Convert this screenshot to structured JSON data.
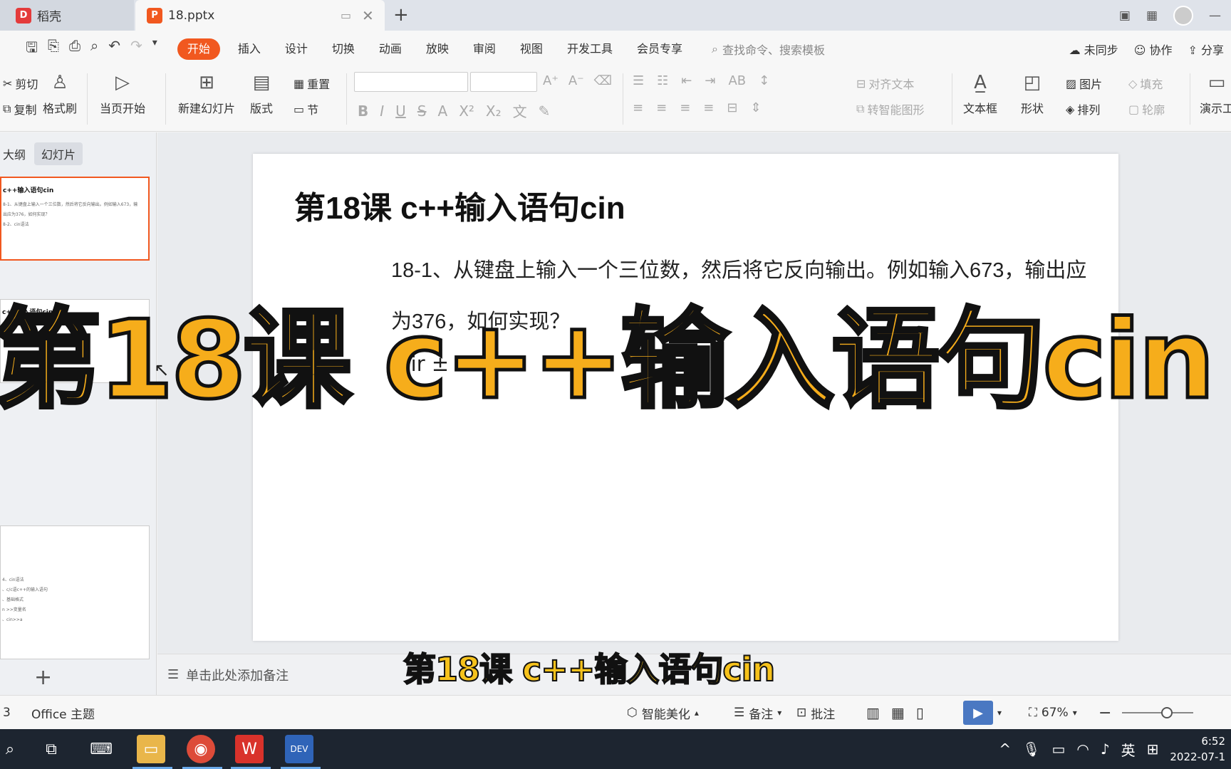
{
  "tabs": {
    "home_label": "稻壳",
    "doc_label": "18.pptx"
  },
  "menu": {
    "items": [
      "开始",
      "插入",
      "设计",
      "切换",
      "动画",
      "放映",
      "审阅",
      "视图",
      "开发工具",
      "会员专享"
    ],
    "search_placeholder": "查找命令、搜索模板",
    "sync_label": "未同步",
    "collab_label": "协作",
    "share_label": "分享"
  },
  "ribbon": {
    "cut": "剪切",
    "copy": "复制",
    "format_painter": "格式刷",
    "play_from_current": "当页开始",
    "new_slide": "新建幻灯片",
    "layout": "版式",
    "reset": "重置",
    "section": "节",
    "align_text": "对齐文本",
    "smart_shape": "转智能图形",
    "textbox": "文本框",
    "shape": "形状",
    "picture": "图片",
    "arrange": "排列",
    "fill": "填充",
    "outline": "轮廓",
    "present_tool": "演示工"
  },
  "left_panel": {
    "tab_outline": "大纲",
    "tab_slides": "幻灯片",
    "thumb1_title": "c++输入语句cin",
    "thumb1_lines": [
      "8-1、从键盘上输入一个三位数，然后将它反向输出。例如输入673，输",
      "出应为376，如何实现？",
      "8-2、cin语法"
    ],
    "thumb2_title": "c++输入语句cin",
    "thumb3_lines": [
      "4、cin语法",
      "、c/c语c++的输入语句",
      "、基础格式",
      "n >>变量名",
      "、cin>>a"
    ]
  },
  "slide": {
    "title": "第18课 c++输入语句cin",
    "body_line": "18-1、从键盘上输入一个三位数，然后将它反向输出。例如输入673，输出应为376，如何实现？",
    "body_partial": "1  ir ±"
  },
  "notes": {
    "placeholder": "单击此处添加备注"
  },
  "status": {
    "slide_count": "3",
    "theme": "Office 主题",
    "beautify": "智能美化",
    "notes": "备注",
    "comments": "批注",
    "zoom": "67%"
  },
  "taskbar": {
    "ime": "英",
    "time": "6:52",
    "date": "2022-07-1"
  },
  "overlay": {
    "big_caption": "第18课 c++输入语句cin",
    "subtitle": "第18课 c++输入语句cin"
  },
  "colors": {
    "accent": "#f1581f",
    "caption": "#f6ad1b"
  }
}
